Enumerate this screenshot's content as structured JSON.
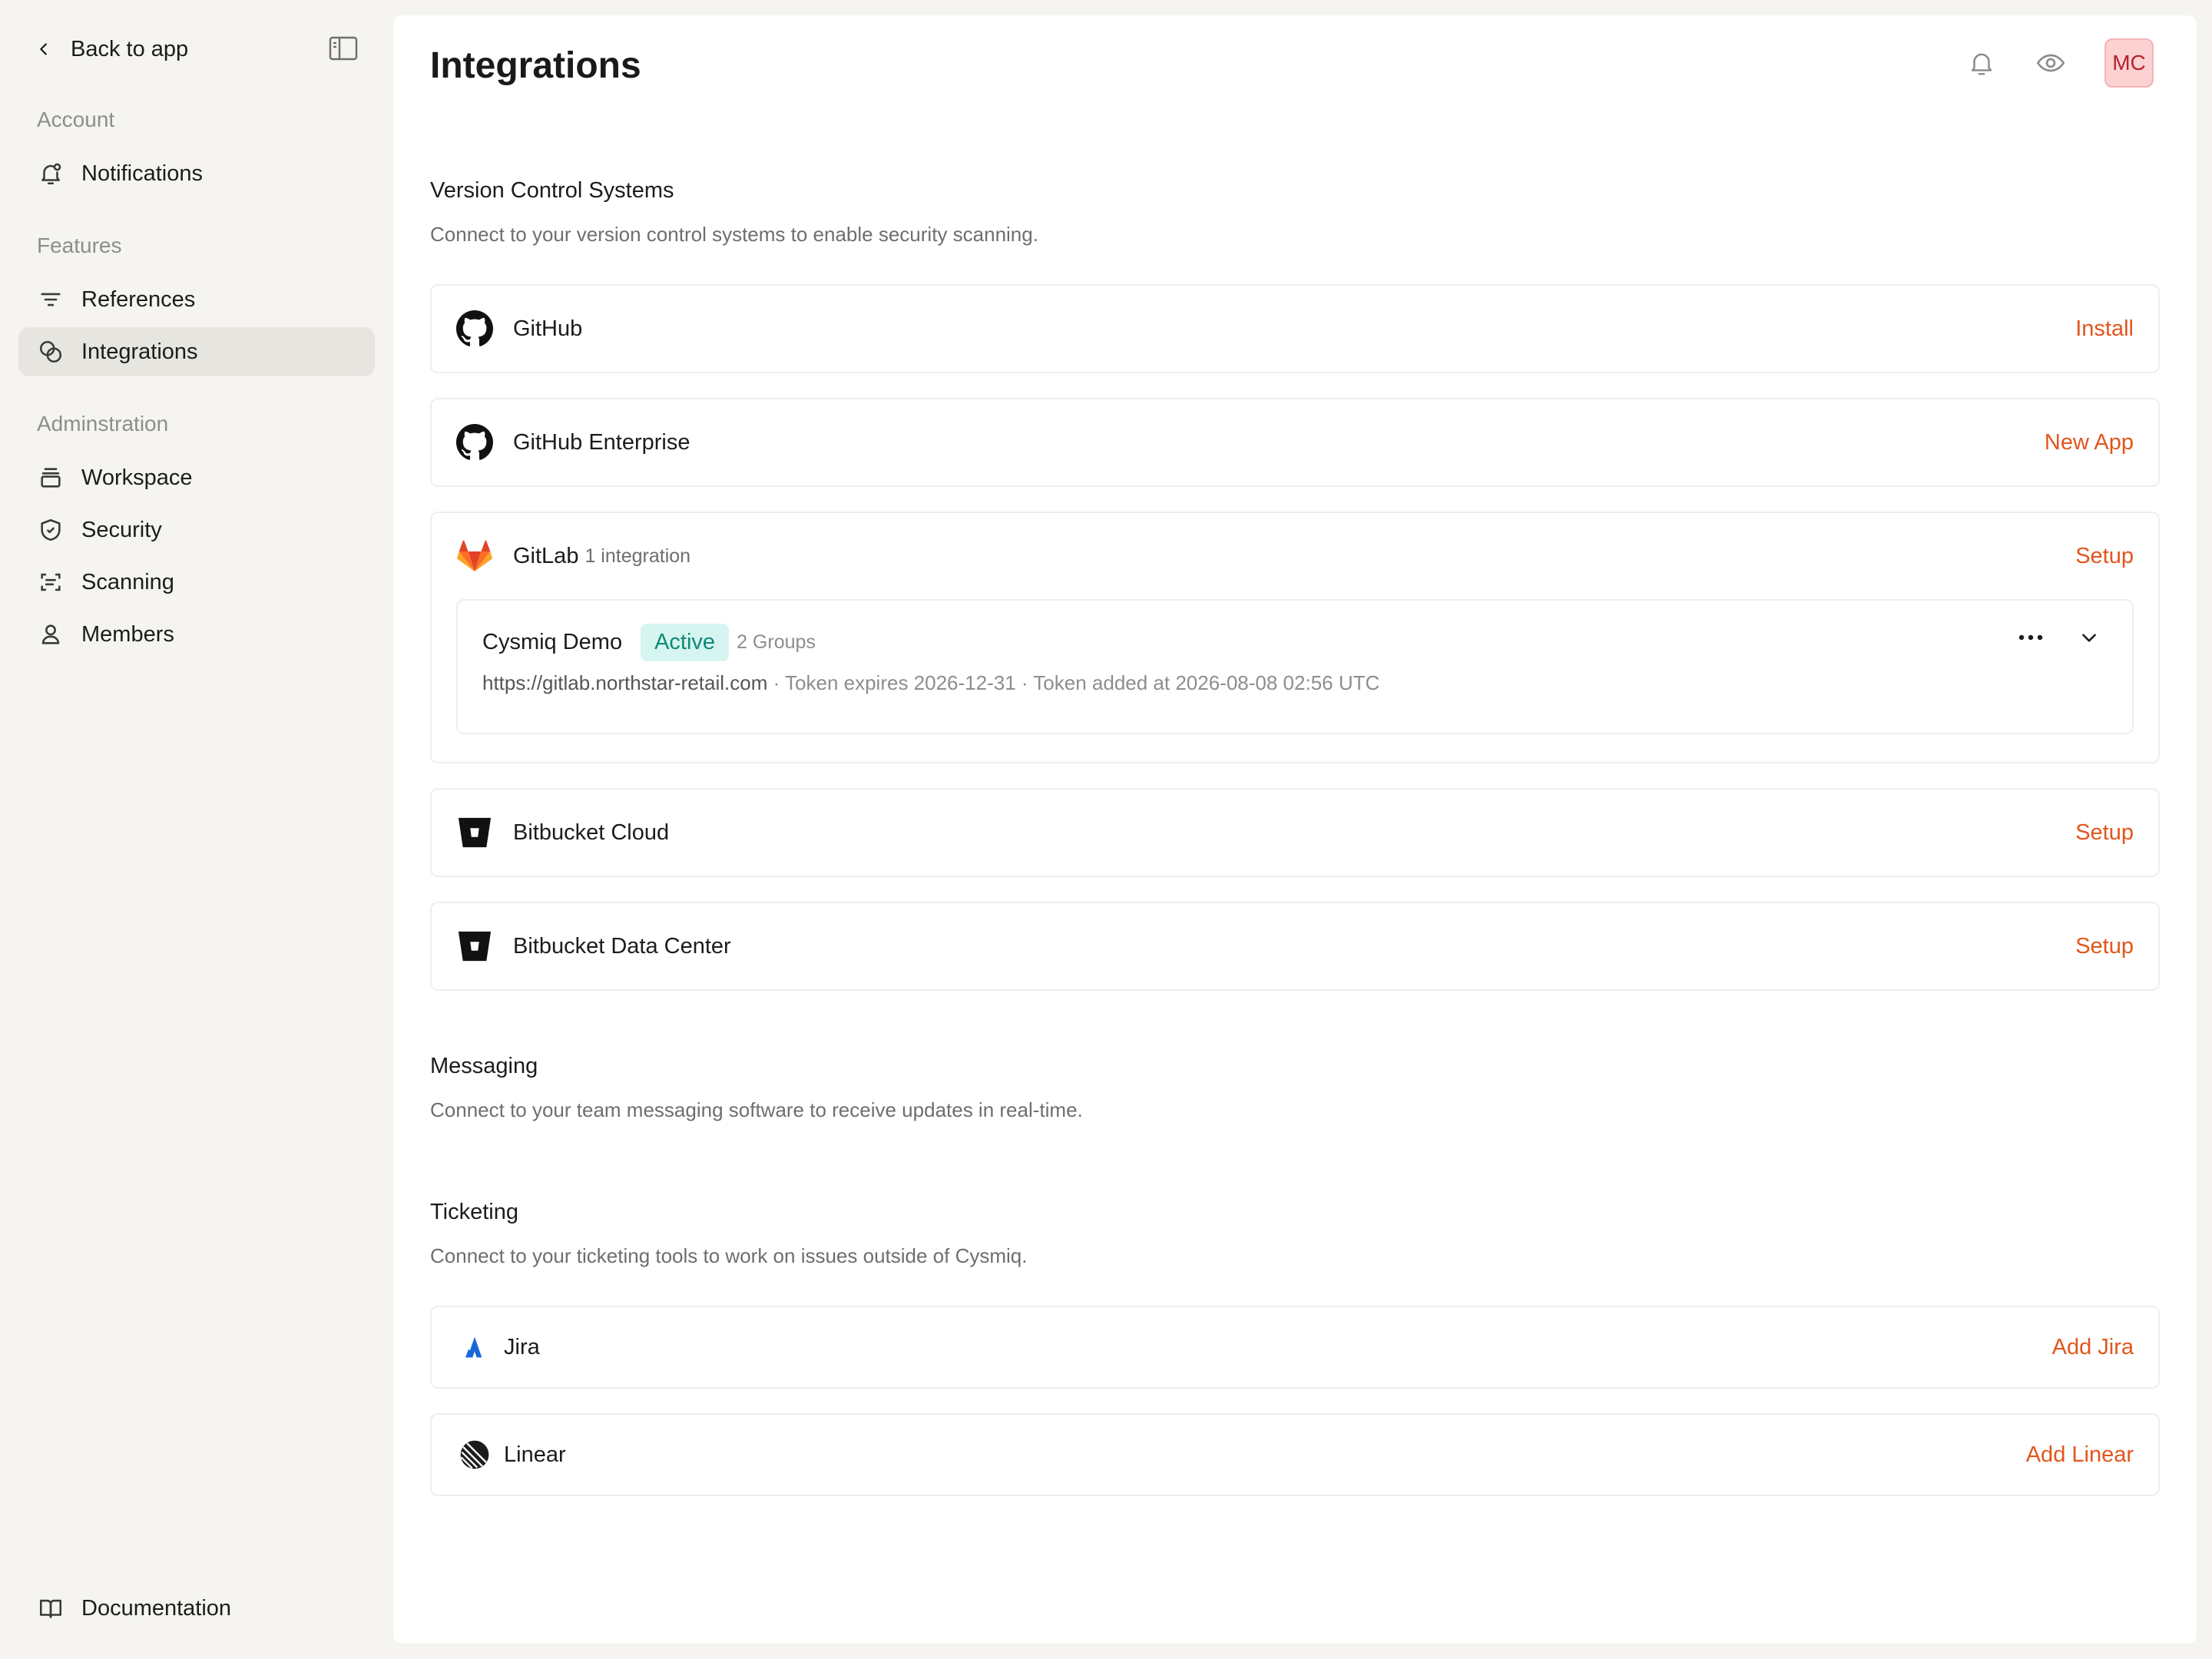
{
  "sidebar": {
    "back_label": "Back to app",
    "sections": [
      {
        "label": "Account",
        "items": [
          {
            "label": "Notifications",
            "icon": "bell-icon"
          }
        ]
      },
      {
        "label": "Features",
        "items": [
          {
            "label": "References",
            "icon": "filter-icon"
          },
          {
            "label": "Integrations",
            "icon": "integrations-icon",
            "active": true
          }
        ]
      },
      {
        "label": "Adminstration",
        "items": [
          {
            "label": "Workspace",
            "icon": "stack-icon"
          },
          {
            "label": "Security",
            "icon": "shield-icon"
          },
          {
            "label": "Scanning",
            "icon": "scan-icon"
          },
          {
            "label": "Members",
            "icon": "user-icon"
          }
        ]
      }
    ],
    "footer_item": {
      "label": "Documentation",
      "icon": "book-icon"
    }
  },
  "header": {
    "title": "Integrations",
    "avatar_initials": "MC"
  },
  "vcs": {
    "title": "Version Control Systems",
    "description": "Connect to your version control systems to enable security scanning.",
    "providers": [
      {
        "name": "GitHub",
        "action": "Install",
        "icon": "github-icon"
      },
      {
        "name": "GitHub Enterprise",
        "action": "New App",
        "icon": "github-icon"
      },
      {
        "name": "GitLab",
        "sub": "1 integration",
        "action": "Setup",
        "icon": "gitlab-icon",
        "integration": {
          "name": "Cysmiq Demo",
          "status": "Active",
          "groups": "2 Groups",
          "url": "https://gitlab.northstar-retail.com",
          "details": " · Token expires 2026-12-31 · Token added at 2026-08-08 02:56 UTC"
        }
      },
      {
        "name": "Bitbucket Cloud",
        "action": "Setup",
        "icon": "bitbucket-icon"
      },
      {
        "name": "Bitbucket Data Center",
        "action": "Setup",
        "icon": "bitbucket-icon"
      }
    ]
  },
  "messaging": {
    "title": "Messaging",
    "description": "Connect to your team messaging software to receive updates in real-time."
  },
  "ticketing": {
    "title": "Ticketing",
    "description": "Connect to your ticketing tools to work on issues outside of Cysmiq.",
    "providers": [
      {
        "name": "Jira",
        "action": "Add Jira",
        "icon": "jira-icon"
      },
      {
        "name": "Linear",
        "action": "Add Linear",
        "icon": "linear-icon"
      }
    ]
  },
  "colors": {
    "accent": "#e2561c",
    "active_badge_bg": "#d6f5f0",
    "active_badge_text": "#0e8a79"
  }
}
